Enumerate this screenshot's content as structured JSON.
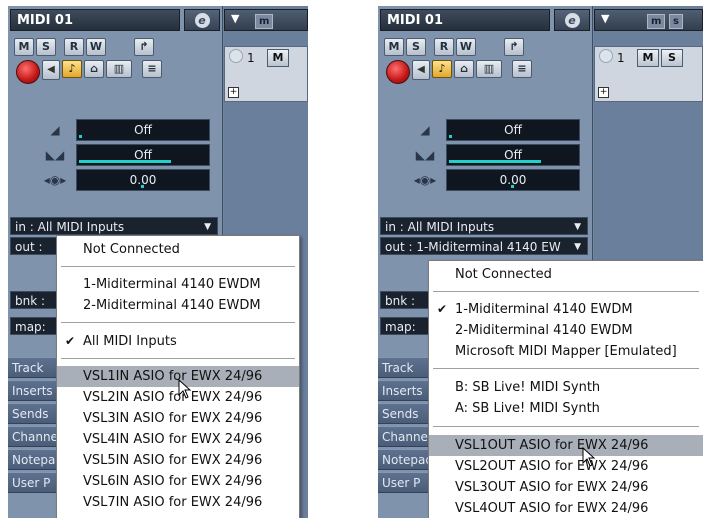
{
  "colors": {
    "track_bg": "#6f86a1",
    "menu_highlight": "#a9afb9",
    "meter": "#21d0c8",
    "record": "#c41515"
  },
  "left": {
    "title": "MIDI 01",
    "edit_icon": "e",
    "buttons": {
      "mute": "M",
      "solo": "S",
      "read": "R",
      "write": "W"
    },
    "sliders": [
      {
        "icon": "volume-icon",
        "value": "Off",
        "level": 0.02
      },
      {
        "icon": "pan-icon",
        "value": "Off",
        "level": 0.7
      },
      {
        "icon": "delay-icon",
        "value": "0.00",
        "level": 0.5
      }
    ],
    "in_label": "in :",
    "in_value": "All MIDI Inputs",
    "out_label": "out :",
    "bnk_label": "bnk :",
    "map_label": "map:",
    "sections": [
      "Track",
      "Inserts",
      "Sends",
      "Channel",
      "Notepad",
      "User P"
    ],
    "project_tab": "m",
    "track_number": "1",
    "track_m": "M",
    "menu": {
      "items": [
        {
          "label": "Not Connected",
          "checked": false,
          "highlighted": false
        },
        {
          "label": "1-Miditerminal 4140 EWDM",
          "checked": false,
          "highlighted": false
        },
        {
          "label": "2-Miditerminal 4140 EWDM",
          "checked": false,
          "highlighted": false
        },
        {
          "label": "All MIDI Inputs",
          "checked": true,
          "highlighted": false
        },
        {
          "label": "VSL1IN ASIO for EWX 24/96",
          "checked": false,
          "highlighted": true
        },
        {
          "label": "VSL2IN ASIO for EWX 24/96",
          "checked": false,
          "highlighted": false
        },
        {
          "label": "VSL3IN ASIO for EWX 24/96",
          "checked": false,
          "highlighted": false
        },
        {
          "label": "VSL4IN ASIO for EWX 24/96",
          "checked": false,
          "highlighted": false
        },
        {
          "label": "VSL5IN ASIO for EWX 24/96",
          "checked": false,
          "highlighted": false
        },
        {
          "label": "VSL6IN ASIO for EWX 24/96",
          "checked": false,
          "highlighted": false
        },
        {
          "label": "VSL7IN ASIO for EWX 24/96",
          "checked": false,
          "highlighted": false
        }
      ]
    }
  },
  "right": {
    "title": "MIDI 01",
    "edit_icon": "e",
    "buttons": {
      "mute": "M",
      "solo": "S",
      "read": "R",
      "write": "W"
    },
    "sliders": [
      {
        "icon": "volume-icon",
        "value": "Off",
        "level": 0.02
      },
      {
        "icon": "pan-icon",
        "value": "Off",
        "level": 0.7
      },
      {
        "icon": "delay-icon",
        "value": "0.00",
        "level": 0.5
      }
    ],
    "in_label": "in :",
    "in_value": "All MIDI Inputs",
    "out_label": "out :",
    "out_value": "1-Miditerminal 4140 EW",
    "bnk_label": "bnk :",
    "map_label": "map:",
    "sections": [
      "Track",
      "Inserts",
      "Sends",
      "Channel",
      "Notepad",
      "User P"
    ],
    "project_tabs": [
      "m",
      "s"
    ],
    "track_number": "1",
    "track_m": "M",
    "track_s": "S",
    "menu": {
      "items": [
        {
          "label": "Not Connected",
          "checked": false,
          "highlighted": false
        },
        {
          "label": "1-Miditerminal 4140 EWDM",
          "checked": true,
          "highlighted": false
        },
        {
          "label": "2-Miditerminal 4140 EWDM",
          "checked": false,
          "highlighted": false
        },
        {
          "label": "Microsoft MIDI Mapper [Emulated]",
          "checked": false,
          "highlighted": false
        },
        {
          "label": "B: SB Live! MIDI Synth",
          "checked": false,
          "highlighted": false
        },
        {
          "label": "A: SB Live! MIDI Synth",
          "checked": false,
          "highlighted": false
        },
        {
          "label": "VSL1OUT ASIO for EWX 24/96",
          "checked": false,
          "highlighted": true
        },
        {
          "label": "VSL2OUT ASIO for EWX 24/96",
          "checked": false,
          "highlighted": false
        },
        {
          "label": "VSL3OUT ASIO for EWX 24/96",
          "checked": false,
          "highlighted": false
        },
        {
          "label": "VSL4OUT ASIO for EWX 24/96",
          "checked": false,
          "highlighted": false
        }
      ]
    }
  }
}
